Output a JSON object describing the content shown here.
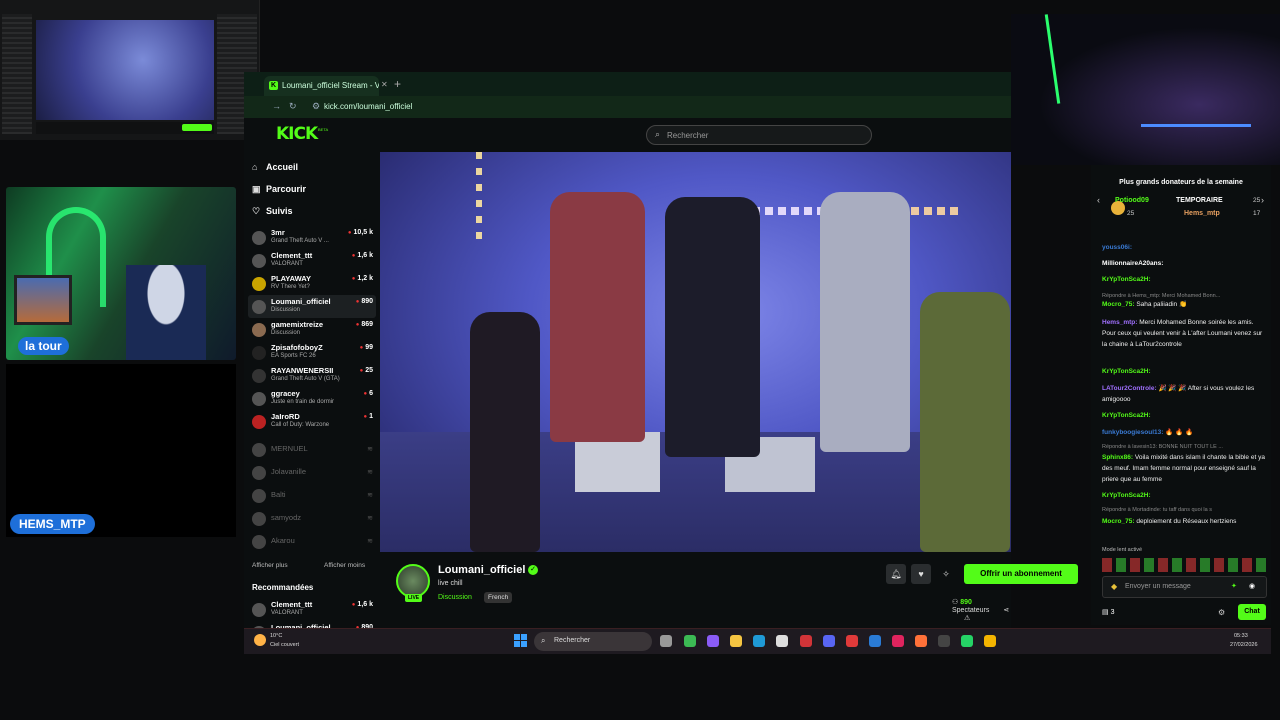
{
  "browser": {
    "tab_title": "Loumani_officiel Stream - V",
    "tab_close": "✕",
    "tab_add": "+",
    "url": "kick.com/loumani_officiel"
  },
  "kick": {
    "logo": "KICK",
    "beta": "BETA",
    "search_placeholder": "Rechercher"
  },
  "nav": {
    "home": "Accueil",
    "browse": "Parcourir",
    "following": "Suivis",
    "show_more": "Afficher plus",
    "show_less": "Afficher moins",
    "recommended": "Recommandées"
  },
  "channels": [
    {
      "name": "3mr",
      "game": "Grand Theft Auto V ...",
      "viewers": "10,5 k"
    },
    {
      "name": "Clement_ttt",
      "game": "VALORANT",
      "viewers": "1,6 k"
    },
    {
      "name": "PLAYAWAY",
      "game": "RV There Yet?",
      "viewers": "1,2 k"
    },
    {
      "name": "Loumani_officiel",
      "game": "Discussion",
      "viewers": "890"
    },
    {
      "name": "gamemixtreize",
      "game": "Discussion",
      "viewers": "869"
    },
    {
      "name": "ZpisafofoboyZ",
      "game": "EA Sports FC 26",
      "viewers": "99"
    },
    {
      "name": "RAYANWENERSII",
      "game": "Grand Theft Auto V (GTA)",
      "viewers": "25"
    },
    {
      "name": "ggracey",
      "game": "Juste en train de dormir",
      "viewers": "6"
    },
    {
      "name": "JaIroRD",
      "game": "Call of Duty: Warzone",
      "viewers": "1"
    }
  ],
  "offline_channels": [
    {
      "name": "MERNUEL",
      "viewers": "≋"
    },
    {
      "name": "Jolavanille",
      "viewers": "≋"
    },
    {
      "name": "Balti",
      "viewers": "≋"
    },
    {
      "name": "samyodz",
      "viewers": "≋"
    },
    {
      "name": "Akarou",
      "viewers": "≋"
    }
  ],
  "recommended_channels": [
    {
      "name": "Clement_ttt",
      "game": "VALORANT",
      "viewers": "1,6 k"
    },
    {
      "name": "Loumani_officiel",
      "game": "",
      "viewers": "890"
    }
  ],
  "stream": {
    "streamer": "Loumani_officiel",
    "live": "LIVE",
    "title": "live chill",
    "category": "Discussion",
    "language": "French",
    "subscribe": "Offrir un abonnement",
    "viewers_count": "890",
    "viewers_label": "Spectateurs"
  },
  "chat": {
    "donors_title": "Plus grands donateurs de la semaine",
    "donor1_name": "Potiood09",
    "donor1_amount": "25",
    "donor2_name": "TEMPORAIRE",
    "donor2_amount": "25",
    "donor3_name": "Hems_mtp",
    "donor3_amount": "17",
    "messages": [
      {
        "reply": "",
        "user": "youss06i:",
        "text": "",
        "color": "#3a7bd5"
      },
      {
        "reply": "",
        "user": "MillionnaireA20ans:",
        "text": "",
        "color": "#ffffff"
      },
      {
        "reply": "",
        "user": "KrYpTonSca2H:",
        "text": "",
        "color": "#53fc18"
      },
      {
        "reply": "",
        "user": "Mocro_75:",
        "text": "Saha paliiadin 👏",
        "color": "#53fc18"
      },
      {
        "reply": "Répondre à Hems_mtp: Merci Mohamed Bonn...",
        "user": "Hems_mtp:",
        "text": "Merci Mohamed Bonne soirée les amis. Pour ceux qui veulent venir à L'after Loumani venez sur la chaine à LaTour2controle",
        "color": "#a070ff"
      },
      {
        "reply": "",
        "user": "KrYpTonSca2H:",
        "text": "",
        "color": "#53fc18"
      },
      {
        "reply": "",
        "user": "LATour2Controle:",
        "text": "🎉 🎉 🎉 After si vous voulez les amigoooo",
        "color": "#a070ff"
      },
      {
        "reply": "",
        "user": "KrYpTonSca2H:",
        "text": "",
        "color": "#53fc18"
      },
      {
        "reply": "",
        "user": "funkyboogiesoul13:",
        "text": "🔥 🔥 🔥",
        "color": "#3a7bd5"
      },
      {
        "reply": "Répondre à lavesin13: BONNE NUIT TOUT LE ...",
        "user": "Sphinx86:",
        "text": "Voila mixité dans islam il chante la bible et ya des meuf. Imam femme normal pour enseigné sauf la priere que au femme",
        "color": "#53fc18"
      },
      {
        "reply": "",
        "user": "KrYpTonSca2H:",
        "text": "",
        "color": "#53fc18"
      },
      {
        "reply": "Répondre à Mortadinde: tu taff dans quoi la s",
        "user": "Mocro_75:",
        "text": "deploiement du Réseaux hertziens",
        "color": "#53fc18"
      }
    ],
    "slow_mode": "Mode lent activé",
    "input_placeholder": "Envoyer un message",
    "count": "3",
    "send_label": "Chat"
  },
  "overlay": {
    "webcam_label": "la tour",
    "user_badge": "HEMS_MTP"
  },
  "taskbar": {
    "temp": "10°C",
    "weather": "Ciel couvert",
    "search": "Rechercher",
    "time": "05:33",
    "date": "27/02/2026"
  },
  "colors": {
    "kick_green": "#53fc18",
    "badge_blue": "#1e6fd9"
  }
}
